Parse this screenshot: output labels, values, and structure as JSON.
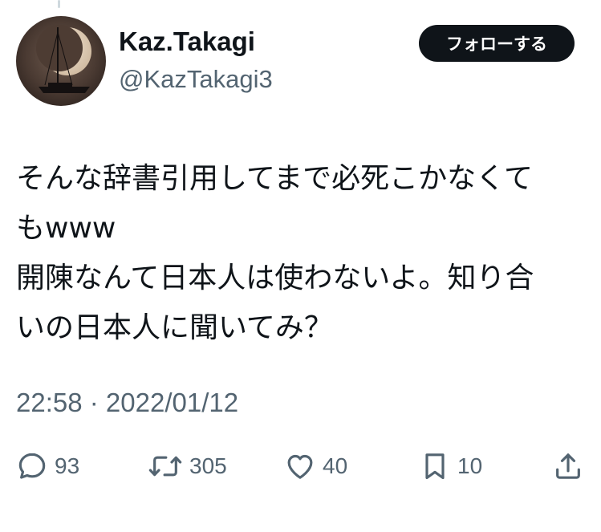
{
  "tweet": {
    "author": {
      "display_name": "Kaz.Takagi",
      "handle": "@KazTakagi3"
    },
    "follow_label": "フォローする",
    "text_lines": [
      "そんな辞書引用してまで必死こかなくて",
      "もwww",
      "開陳なんて日本人は使わないよ。知り合",
      "いの日本人に聞いてみ？"
    ],
    "timestamp": "22:58 · 2022/01/12",
    "metrics": {
      "replies": "93",
      "retweets": "305",
      "likes": "40",
      "bookmarks": "10"
    }
  },
  "icons": {
    "reply": "reply-bubble-icon",
    "retweet": "retweet-arrows-icon",
    "like": "heart-icon",
    "bookmark": "bookmark-icon",
    "share": "share-upload-icon"
  },
  "colors": {
    "text": "#0f1419",
    "secondary": "#536471",
    "button_bg": "#0f1419",
    "button_text": "#ffffff",
    "background": "#ffffff"
  }
}
